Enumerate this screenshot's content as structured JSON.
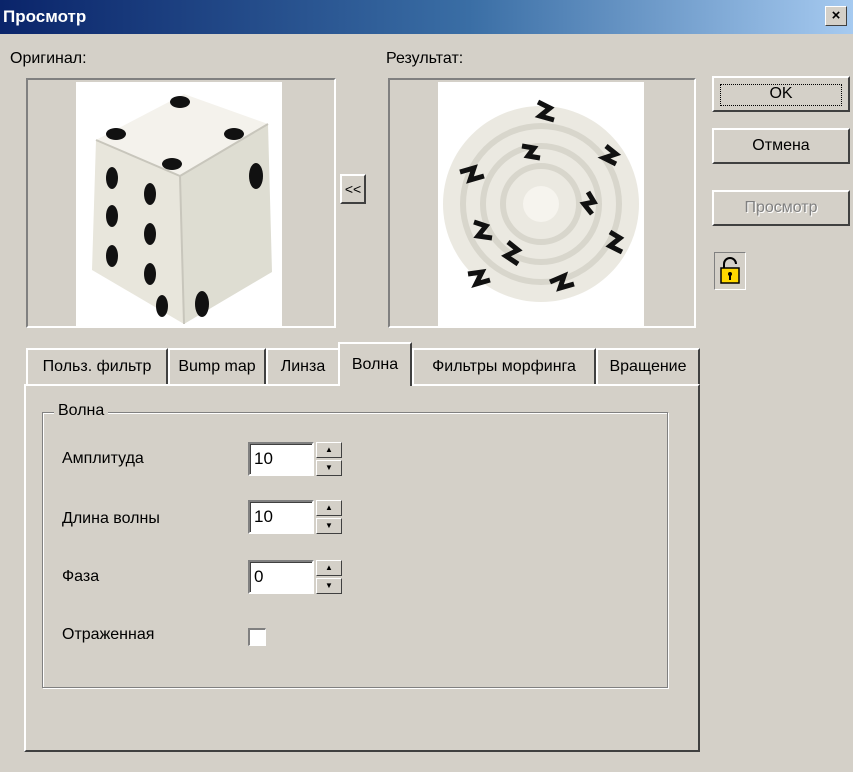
{
  "window": {
    "title": "Просмотр",
    "close_label": "×"
  },
  "preview": {
    "original_label": "Оригинал:",
    "result_label": "Результат:",
    "copy_button_label": "<<"
  },
  "buttons": {
    "ok": "OK",
    "cancel": "Отмена",
    "preview": "Просмотр",
    "lock_icon": "lock-icon"
  },
  "tabs": [
    {
      "label": "Польз. фильтр"
    },
    {
      "label": "Bump map"
    },
    {
      "label": "Линза"
    },
    {
      "label": "Волна",
      "active": true
    },
    {
      "label": "Фильтры морфинга"
    },
    {
      "label": "Вращение"
    }
  ],
  "wave": {
    "group_title": "Волна",
    "amplitude_label": "Амплитуда",
    "amplitude_value": "10",
    "wavelength_label": "Длина волны",
    "wavelength_value": "10",
    "phase_label": "Фаза",
    "phase_value": "0",
    "reflected_label": "Отраженная",
    "reflected_checked": false
  },
  "colors": {
    "face": "#d4d0c8",
    "title_start": "#0a246a",
    "title_end": "#a6caf0",
    "disabled_text": "#808080"
  }
}
